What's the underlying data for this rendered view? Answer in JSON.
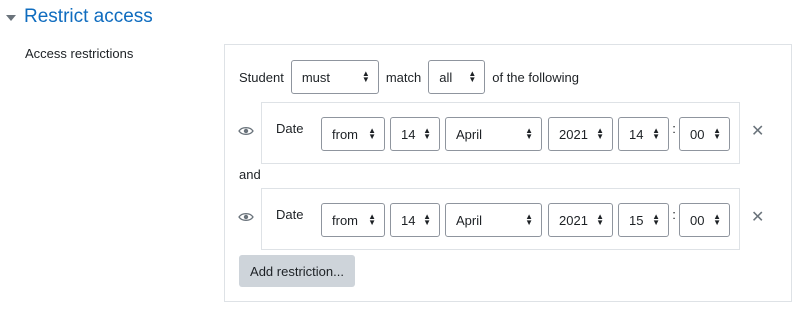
{
  "section": {
    "title": "Restrict access",
    "caret_icon": "chevron-down-icon"
  },
  "field_label": "Access restrictions",
  "match_row": {
    "prefix": "Student",
    "must_value": "must",
    "middle": "match",
    "all_value": "all",
    "suffix": "of the following"
  },
  "conditions": [
    {
      "type_label": "Date",
      "direction": "from",
      "day": "14",
      "month": "April",
      "year": "2021",
      "hour": "14",
      "minute": "00",
      "colon": ":"
    },
    {
      "type_label": "Date",
      "direction": "from",
      "day": "14",
      "month": "April",
      "year": "2021",
      "hour": "15",
      "minute": "00",
      "colon": ":"
    }
  ],
  "and_label": "and",
  "add_button": "Add restriction...",
  "delete_glyph": "✕",
  "select_arrows": {
    "up": "▲",
    "down": "▼"
  },
  "colors": {
    "title": "#0f6cbf",
    "button_bg": "#ced4da",
    "border": "#dee2e6"
  }
}
